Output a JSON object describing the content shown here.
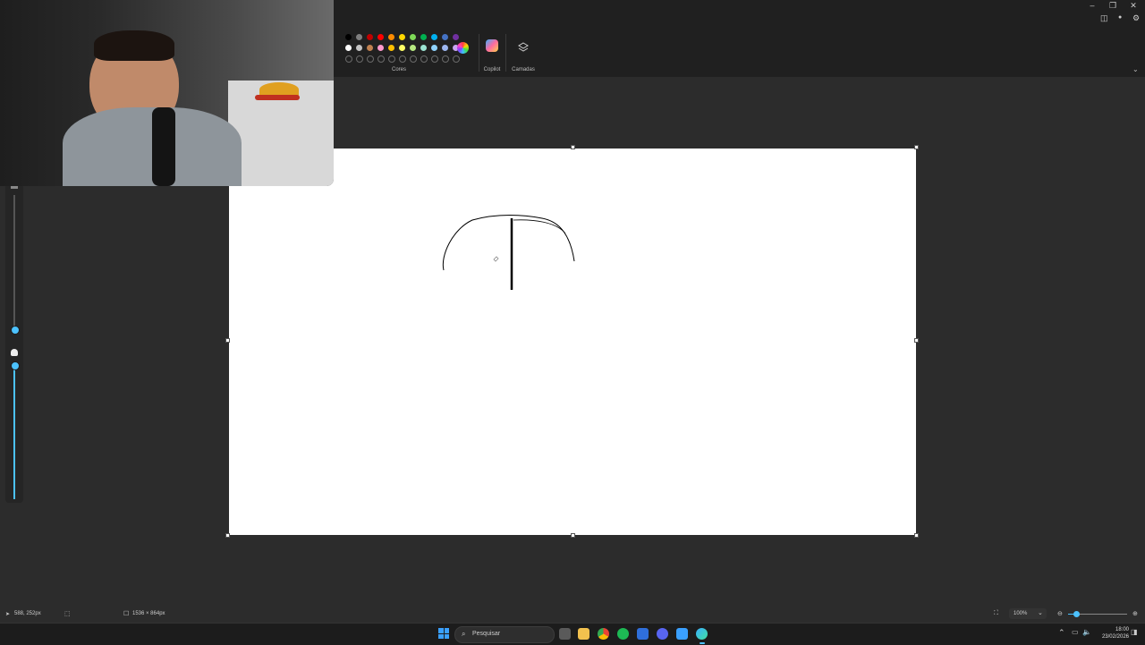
{
  "ribbon": {
    "colors_label": "Cores",
    "copilot_label": "Copilot",
    "layers_label": "Camadas",
    "palette_row1": [
      "#000000",
      "#7f7f7f",
      "#c00000",
      "#ff0000",
      "#ff8c00",
      "#ffd700",
      "#7ed957",
      "#00b050",
      "#00b0f0",
      "#4472c4",
      "#7030a0"
    ],
    "palette_row2": [
      "#ffffff",
      "#c3c3c3",
      "#c08050",
      "#ff99cc",
      "#ffc000",
      "#ffff66",
      "#b6e880",
      "#9be3d2",
      "#8fd3ff",
      "#9db7f0",
      "#c9a6f0"
    ]
  },
  "status": {
    "cursor_position": "588, 252px",
    "canvas_size": "1536 × 864px",
    "zoom_level": "100%"
  },
  "taskbar": {
    "search_placeholder": "Pesquisar",
    "time": "18:00",
    "date": "23/02/2026"
  },
  "colors": {
    "accent": "#4cc2ff",
    "app_background": "#2c2c2c",
    "canvas": "#ffffff"
  }
}
